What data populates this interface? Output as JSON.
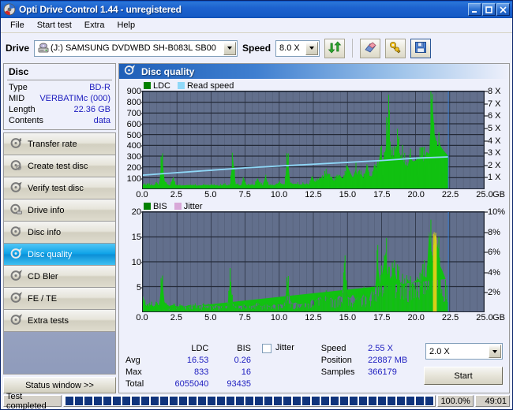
{
  "window": {
    "title": "Opti Drive Control 1.44 - unregistered",
    "title_icon": "disc-icon",
    "minimize": "_",
    "maximize": "□",
    "close": "✕"
  },
  "menu": {
    "items": [
      {
        "label": "File"
      },
      {
        "label": "Start test"
      },
      {
        "label": "Extra"
      },
      {
        "label": "Help"
      }
    ]
  },
  "toolbar": {
    "drive_label": "Drive",
    "drive_value": "(J:)   SAMSUNG DVDWBD SH-B083L SB00",
    "speed_label": "Speed",
    "speed_value": "8.0 X",
    "buttons": [
      {
        "name": "refresh-icon",
        "title": "Refresh"
      },
      {
        "name": "eraser-icon",
        "title": "Erase"
      },
      {
        "name": "tools-icon",
        "title": "Tools"
      },
      {
        "name": "save-icon",
        "title": "Save"
      }
    ]
  },
  "sidebar": {
    "disc": {
      "title": "Disc",
      "rows": [
        {
          "key": "Type",
          "value": "BD-R"
        },
        {
          "key": "MID",
          "value": "VERBATIMc (000)"
        },
        {
          "key": "Length",
          "value": "22.36 GB"
        },
        {
          "key": "Contents",
          "value": "data"
        }
      ]
    },
    "nav": [
      {
        "label": "Transfer rate",
        "icon": "disc-icon",
        "active": false
      },
      {
        "label": "Create test disc",
        "icon": "disc-icon",
        "active": false
      },
      {
        "label": "Verify test disc",
        "icon": "disc-icon",
        "active": false
      },
      {
        "label": "Drive info",
        "icon": "disc-icon",
        "active": false
      },
      {
        "label": "Disc info",
        "icon": "disc-icon",
        "active": false
      },
      {
        "label": "Disc quality",
        "icon": "disc-icon",
        "active": true
      },
      {
        "label": "CD Bler",
        "icon": "disc-icon",
        "active": false
      },
      {
        "label": "FE / TE",
        "icon": "disc-icon",
        "active": false
      },
      {
        "label": "Extra tests",
        "icon": "disc-icon",
        "active": false
      }
    ],
    "status_window_button": "Status window >>"
  },
  "main": {
    "panel_title": "Disc quality",
    "panel_icon": "disc-icon"
  },
  "stats": {
    "header": {
      "ldc": "LDC",
      "bis": "BIS"
    },
    "rows": [
      {
        "label": "Avg",
        "ldc": "16.53",
        "bis": "0.26"
      },
      {
        "label": "Max",
        "ldc": "833",
        "bis": "16"
      },
      {
        "label": "Total",
        "ldc": "6055040",
        "bis": "93435"
      }
    ],
    "jitter_label": "Jitter",
    "jitter_checked": false,
    "info": [
      {
        "label": "Speed",
        "value": "2.55 X"
      },
      {
        "label": "Position",
        "value": "22887 MB"
      },
      {
        "label": "Samples",
        "value": "366179"
      }
    ],
    "speed_select": "2.0 X",
    "start_button": "Start"
  },
  "statusbar": {
    "message": "Test completed",
    "percent": "100.0%",
    "time": "49:01",
    "progress_value": 100
  },
  "colors": {
    "accent_blue": "#1d62cf",
    "plot_background": "#626f8c",
    "grid": "#272d3c",
    "ldc_green": "#11c111",
    "read_speed_blue": "#8fd8f8",
    "bis_green": "#11c111",
    "jitter_pink": "#d8a8d8",
    "marker_line": "#2b7ad4",
    "value_text": "#2020c0"
  },
  "chart_data": [
    {
      "type": "area",
      "title": "LDC / Read speed",
      "legend": [
        {
          "label": "LDC",
          "color": "#008000"
        },
        {
          "label": "Read speed",
          "color": "#8fd8f8"
        }
      ],
      "legend_position": "top-left",
      "xlabel": "GB",
      "ylabel": "LDC",
      "y2label": "Read speed (X)",
      "xlim": [
        0.0,
        25.0
      ],
      "ylim": [
        0,
        900
      ],
      "y2lim": [
        0,
        8
      ],
      "grid": true,
      "xticks": [
        "0.0",
        "2.5",
        "5.0",
        "7.5",
        "10.0",
        "12.5",
        "15.0",
        "17.5",
        "20.0",
        "22.5",
        "25.0"
      ],
      "yticks": [
        100,
        200,
        300,
        400,
        500,
        600,
        700,
        800,
        900
      ],
      "y2ticks": [
        "1 X",
        "2 X",
        "3 X",
        "4 X",
        "5 X",
        "6 X",
        "7 X",
        "8 X"
      ],
      "data_end_x": 22.4,
      "marker_x": 22.4,
      "series": [
        {
          "name": "LDC",
          "color": "#11c111",
          "x": [
            0.0,
            0.2,
            0.4,
            0.6,
            0.8,
            1.0,
            1.2,
            1.4,
            1.6,
            1.8,
            2.0,
            2.2,
            2.4,
            2.6,
            2.8,
            3.0,
            3.2,
            3.4,
            3.6,
            3.8,
            4.0,
            4.2,
            4.4,
            4.6,
            4.8,
            5.0,
            5.2,
            5.4,
            5.6,
            5.8,
            6.0,
            6.2,
            6.4,
            6.6,
            6.8,
            7.0,
            7.2,
            7.4,
            7.6,
            7.8,
            8.0,
            8.2,
            8.4,
            8.6,
            8.8,
            9.0,
            9.2,
            9.4,
            9.6,
            9.8,
            10.0,
            10.2,
            10.4,
            10.6,
            10.8,
            11.0,
            11.2,
            11.4,
            11.6,
            11.8,
            12.0,
            12.2,
            12.4,
            12.6,
            12.8,
            13.0,
            13.2,
            13.4,
            13.6,
            13.8,
            14.0,
            14.2,
            14.4,
            14.6,
            14.8,
            15.0,
            15.2,
            15.4,
            15.6,
            15.8,
            16.0,
            16.2,
            16.4,
            16.6,
            16.8,
            17.0,
            17.2,
            17.4,
            17.6,
            17.8,
            18.0,
            18.2,
            18.4,
            18.6,
            18.8,
            19.0,
            19.2,
            19.4,
            19.6,
            19.8,
            20.0,
            20.2,
            20.4,
            20.6,
            20.8,
            21.0,
            21.2,
            21.4,
            21.6,
            21.8,
            22.0,
            22.2,
            22.4
          ],
          "values": [
            40,
            30,
            35,
            28,
            30,
            45,
            32,
            310,
            60,
            30,
            28,
            95,
            34,
            30,
            26,
            28,
            30,
            32,
            28,
            30,
            26,
            28,
            30,
            34,
            28,
            30,
            32,
            28,
            26,
            30,
            34,
            28,
            30,
            290,
            40,
            30,
            28,
            95,
            32,
            28,
            34,
            30,
            95,
            40,
            30,
            110,
            34,
            28,
            30,
            36,
            60,
            40,
            38,
            300,
            55,
            40,
            44,
            38,
            36,
            40,
            38,
            36,
            120,
            60,
            70,
            100,
            80,
            140,
            90,
            110,
            70,
            90,
            130,
            95,
            100,
            210,
            150,
            100,
            170,
            110,
            140,
            90,
            200,
            120,
            110,
            230,
            160,
            330,
            250,
            360,
            630,
            300,
            290,
            400,
            310,
            280,
            230,
            200,
            300,
            250,
            260,
            280,
            300,
            250,
            340,
            320,
            840,
            500,
            390,
            400,
            360,
            330,
            300
          ]
        },
        {
          "name": "Read speed",
          "color": "#8fd8f8",
          "unit": "X",
          "x": [
            0.0,
            2.5,
            5.0,
            7.5,
            10.0,
            12.5,
            15.0,
            17.5,
            20.0,
            22.4
          ],
          "values": [
            1.1,
            1.3,
            1.5,
            1.7,
            1.85,
            2.0,
            2.15,
            2.3,
            2.5,
            2.6
          ]
        }
      ]
    },
    {
      "type": "area",
      "title": "BIS / Jitter",
      "legend": [
        {
          "label": "BIS",
          "color": "#008000"
        },
        {
          "label": "Jitter",
          "color": "#d8a8d8"
        }
      ],
      "legend_position": "top-left",
      "xlabel": "GB",
      "ylabel": "BIS",
      "y2label": "Jitter (%)",
      "xlim": [
        0.0,
        25.0
      ],
      "ylim": [
        0,
        20
      ],
      "y2lim": [
        0,
        10
      ],
      "grid": true,
      "xticks": [
        "0.0",
        "2.5",
        "5.0",
        "7.5",
        "10.0",
        "12.5",
        "15.0",
        "17.5",
        "20.0",
        "22.5",
        "25.0"
      ],
      "yticks": [
        5,
        10,
        15,
        20
      ],
      "y2ticks": [
        "2%",
        "4%",
        "6%",
        "8%",
        "10%"
      ],
      "data_end_x": 22.4,
      "marker_x": 22.4,
      "series": [
        {
          "name": "BIS",
          "color": "#11c111",
          "x": [
            0.0,
            0.2,
            0.4,
            0.6,
            0.8,
            1.0,
            1.2,
            1.4,
            1.6,
            1.8,
            2.0,
            2.2,
            2.4,
            2.6,
            2.8,
            3.0,
            3.2,
            3.4,
            3.6,
            3.8,
            4.0,
            4.2,
            4.4,
            4.6,
            4.8,
            5.0,
            5.2,
            5.4,
            5.6,
            5.8,
            6.0,
            6.2,
            6.4,
            6.6,
            6.8,
            7.0,
            7.2,
            7.4,
            7.6,
            7.8,
            8.0,
            8.2,
            8.4,
            8.6,
            8.8,
            9.0,
            9.2,
            9.4,
            9.6,
            9.8,
            10.0,
            10.2,
            10.4,
            10.6,
            10.8,
            11.0,
            11.2,
            11.4,
            11.6,
            11.8,
            12.0,
            12.2,
            12.4,
            12.6,
            12.8,
            13.0,
            13.2,
            13.4,
            13.6,
            13.8,
            14.0,
            14.2,
            14.4,
            14.6,
            14.8,
            15.0,
            15.2,
            15.4,
            15.6,
            15.8,
            16.0,
            16.2,
            16.4,
            16.6,
            16.8,
            17.0,
            17.2,
            17.4,
            17.6,
            17.8,
            18.0,
            18.2,
            18.4,
            18.6,
            18.8,
            19.0,
            19.2,
            19.4,
            19.6,
            19.8,
            20.0,
            20.2,
            20.4,
            20.6,
            20.8,
            21.0,
            21.2,
            21.4,
            21.6,
            21.8,
            22.0,
            22.2,
            22.4
          ],
          "values": [
            3,
            1.2,
            1,
            1.4,
            1,
            1.5,
            1.2,
            6.8,
            1.6,
            1,
            1.1,
            1.3,
            1.1,
            1,
            1.2,
            1,
            1.1,
            1.3,
            1,
            1.2,
            1,
            1.1,
            1.4,
            1,
            1.2,
            1.1,
            1,
            1.3,
            1,
            1.1,
            1.2,
            1,
            6.1,
            1.5,
            1,
            1.2,
            1.1,
            1.4,
            1,
            1.2,
            1.1,
            1.3,
            1.8,
            1.2,
            1,
            1.6,
            1.2,
            1,
            1.4,
            1.2,
            1.5,
            1.3,
            1.7,
            6.1,
            2.2,
            1.6,
            1.8,
            1.5,
            1.4,
            1.7,
            1.6,
            1.5,
            2.4,
            2,
            2.6,
            3,
            2.2,
            3.2,
            2.4,
            2.8,
            2.2,
            2.6,
            3.2,
            2.8,
            8.8,
            3,
            2.6,
            3.4,
            2.4,
            3,
            2.4,
            3.6,
            2.8,
            2.4,
            4.6,
            3.5,
            10,
            5.5,
            8.4,
            12,
            6,
            6.4,
            9,
            6.5,
            6,
            5.2,
            4.6,
            6.5,
            5.6,
            5.8,
            6.2,
            6.6,
            5.6,
            7.2,
            6.8,
            16.2,
            10.5,
            8.4,
            13.8,
            9.2,
            8,
            6.5
          ]
        }
      ]
    }
  ]
}
